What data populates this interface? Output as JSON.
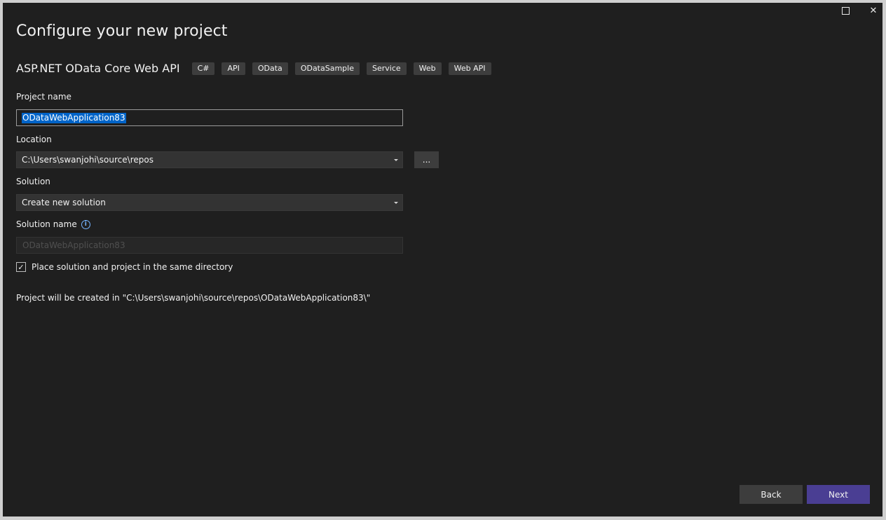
{
  "window": {
    "title": "Configure your new project",
    "maximize_icon": "maximize-icon",
    "close_glyph": "✕"
  },
  "template": {
    "name": "ASP.NET OData Core Web API",
    "tags": [
      "C#",
      "API",
      "OData",
      "ODataSample",
      "Service",
      "Web",
      "Web API"
    ]
  },
  "project_name": {
    "label": "Project name",
    "value": "ODataWebApplication83"
  },
  "location": {
    "label": "Location",
    "value": "C:\\Users\\swanjohi\\source\\repos",
    "browse_label": "..."
  },
  "solution": {
    "label": "Solution",
    "value": "Create new solution"
  },
  "solution_name": {
    "label": "Solution name",
    "info_glyph": "i",
    "value": "ODataWebApplication83"
  },
  "same_directory": {
    "label": "Place solution and project in the same directory",
    "checked": true,
    "check_glyph": "✓"
  },
  "path_message": "Project will be created in \"C:\\Users\\swanjohi\\source\\repos\\ODataWebApplication83\\\"",
  "footer": {
    "back_label": "Back",
    "next_label": "Next"
  },
  "colors": {
    "background": "#1f1f1f",
    "accent": "#4a3e93",
    "selection": "#0064c8",
    "info": "#75b3ff"
  }
}
